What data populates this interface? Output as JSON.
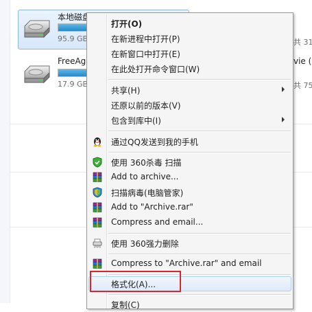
{
  "drives": [
    {
      "name": "本地磁盘",
      "size": "95.9 GB",
      "fill": 0.74,
      "selected": true
    },
    {
      "name": "FreeAge",
      "size": "17.9 GB",
      "fill": 0.72,
      "selected": false
    }
  ],
  "right_fragments": {
    "drive1_size_tail": "共 31.",
    "drive2_name_tail": "vie (F",
    "drive2_size_tail": "共 75."
  },
  "context_menu": {
    "items": [
      {
        "label": "打开(O)",
        "bold": true
      },
      {
        "label": "在新进程中打开(P)"
      },
      {
        "label": "在新窗口中打开(E)"
      },
      {
        "label": "在此处打开命令窗口(W)"
      },
      {
        "label": "共享(H)",
        "submenu": true
      },
      {
        "label": "还原以前的版本(V)"
      },
      {
        "label": "包含到库中(I)",
        "submenu": true
      },
      {
        "label": "通过QQ发送到我的手机",
        "icon": "qq-penguin-icon"
      },
      {
        "label": "使用 360杀毒 扫描",
        "icon": "360-antivirus-icon"
      },
      {
        "label": "Add to archive...",
        "icon": "winrar-icon"
      },
      {
        "label": "扫描病毒(电脑管家)",
        "icon": "tencent-guard-icon"
      },
      {
        "label": "Add to \"Archive.rar\"",
        "icon": "winrar-icon"
      },
      {
        "label": "Compress and email...",
        "icon": "winrar-icon"
      },
      {
        "label": "使用 360强力删除",
        "icon": "360-shred-icon"
      },
      {
        "label": "Compress to \"Archive.rar\" and email",
        "icon": "winrar-icon"
      },
      {
        "label": "格式化(A)...",
        "hover": true
      },
      {
        "label": "复制(C)"
      }
    ]
  },
  "colors": {
    "highlight": "#d9262c",
    "selection": "#d7e8fb",
    "bar_fill": "#2689c9"
  }
}
